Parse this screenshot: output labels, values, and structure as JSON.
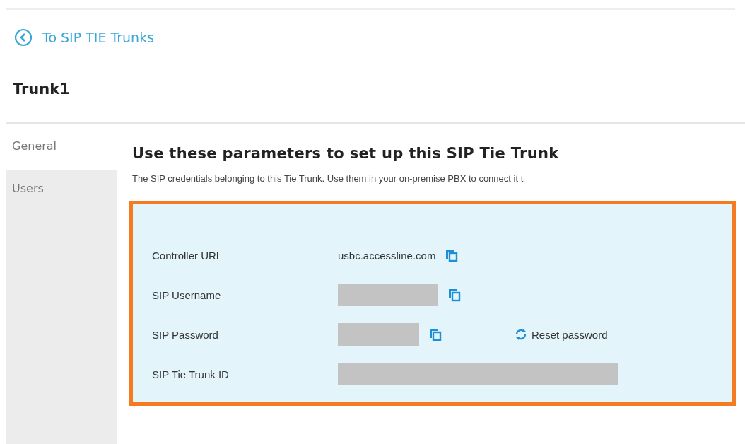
{
  "back_link": {
    "label": "To SIP TIE Trunks"
  },
  "title": "Trunk1",
  "tabs": [
    {
      "label": "General",
      "selected": true
    },
    {
      "label": "Users",
      "selected": false
    }
  ],
  "section": {
    "heading": "Use these parameters to set up this SIP Tie Trunk",
    "description": "The SIP credentials belonging to this Tie Trunk. Use them in your on-premise PBX to connect it t"
  },
  "credentials": [
    {
      "label": "Controller URL",
      "kind": "text",
      "value": "usbc.accessline.com",
      "copy": true
    },
    {
      "label": "SIP Username",
      "kind": "masked",
      "copy": true
    },
    {
      "label": "SIP Password",
      "kind": "masked",
      "copy": true,
      "action": "Reset password"
    },
    {
      "label": "SIP Tie Trunk ID",
      "kind": "masked",
      "copy": false
    }
  ]
}
